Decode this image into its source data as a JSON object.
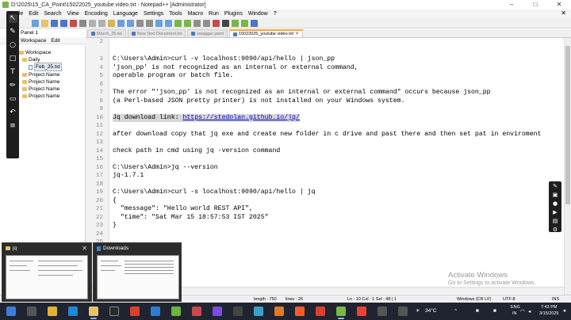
{
  "window": {
    "title": "D:\\2025\\15_CA_Point\\15022025_youtube video.txt - Notepad++ [Administrator]",
    "controls": [
      "–",
      "□",
      "✕"
    ]
  },
  "menu": {
    "items": [
      "File",
      "Edit",
      "Search",
      "View",
      "Encoding",
      "Language",
      "Settings",
      "Tools",
      "Macro",
      "Run",
      "Plugins",
      "Window",
      "?"
    ],
    "close_glyph": "✕"
  },
  "panel": {
    "header": "Panel 1",
    "tabs": [
      "Workspace",
      "Edit"
    ],
    "tree": [
      {
        "label": "Workspace",
        "type": "folder",
        "indent": 0
      },
      {
        "label": "Daily",
        "type": "folder",
        "indent": 1
      },
      {
        "label": "Feb_25.txt",
        "type": "file",
        "indent": 2,
        "selected": true
      },
      {
        "label": "Project Name",
        "type": "folder",
        "indent": 1
      },
      {
        "label": "Project Name",
        "type": "folder",
        "indent": 1
      },
      {
        "label": "Project Name",
        "type": "folder",
        "indent": 1
      },
      {
        "label": "Project Name",
        "type": "folder",
        "indent": 1
      }
    ]
  },
  "tabs": [
    {
      "label": "March_25.txt",
      "active": false
    },
    {
      "label": "New Text Document.txt",
      "active": false
    },
    {
      "label": "swagger.yaml",
      "active": false
    },
    {
      "label": "15022025_youtube video.txt",
      "active": true
    }
  ],
  "editor": {
    "lines": [
      {
        "n": "2",
        "text": ""
      },
      {
        "n": "3",
        "text": "C:\\Users\\Admin>curl -v localhost:9090/api/hello | json_pp"
      },
      {
        "n": "4",
        "text": "'json_pp' is not recognized as an internal or external command,"
      },
      {
        "n": "5",
        "text": "operable program or batch file."
      },
      {
        "n": "6",
        "text": ""
      },
      {
        "n": "7",
        "text": "The error \"'json_pp' is not recognized as an internal or external command\" occurs because json_pp"
      },
      {
        "n": "8",
        "text": "(a Perl-based JSON pretty printer) is not installed on your Windows system."
      },
      {
        "n": "9",
        "text": ""
      },
      {
        "n": "10",
        "text": "Jq download link: ",
        "link": "https://stedolan.github.io/jq/",
        "highlight": true
      },
      {
        "n": "11",
        "text": ""
      },
      {
        "n": "12",
        "text": "after download copy that jq exe and create new folder in c drive and past there and then set pat in enviroment"
      },
      {
        "n": "13",
        "text": ""
      },
      {
        "n": "14",
        "text": "check path in cmd using jq -version command"
      },
      {
        "n": "15",
        "text": ""
      },
      {
        "n": "16",
        "text": "C:\\Users\\Admin>jq --version"
      },
      {
        "n": "17",
        "text": "jq-1.7.1"
      },
      {
        "n": "18",
        "text": ""
      },
      {
        "n": "19",
        "text": "C:\\Users\\Admin>curl -s localhost:9090/api/hello | jq"
      },
      {
        "n": "20",
        "text": "{"
      },
      {
        "n": "21",
        "text": "  \"message\": \"Hello world REST API\","
      },
      {
        "n": "22",
        "text": "  \"time\": \"Sat Mar 15 18:57:53 IST 2025\""
      },
      {
        "n": "23",
        "text": "}"
      },
      {
        "n": "24",
        "text": ""
      },
      {
        "n": "25",
        "text": ""
      },
      {
        "n": "26",
        "text": ""
      }
    ]
  },
  "statusbar": {
    "length": "length : 750",
    "lines": "lines : 26",
    "position": "Ln : 10    Col : 1    Sel : 48 | 1",
    "eol": "Windows (CR LF)",
    "encoding": "UTF-8",
    "mode": "INS"
  },
  "watermark": {
    "title": "Activate Windows",
    "subtitle": "Go to Settings to activate Windows."
  },
  "thumbnails": [
    {
      "title": "jq",
      "close": "✕"
    },
    {
      "title": "Downloads"
    }
  ],
  "taskbar": {
    "weather": "34°C",
    "lang_top": "ENG",
    "lang_bottom": "IN",
    "time": "7:43 PM",
    "date": "3/15/2025"
  },
  "colors": {
    "accent_tab": "#f3a43a",
    "link": "#0000cc",
    "taskbar": "#1f2430"
  }
}
